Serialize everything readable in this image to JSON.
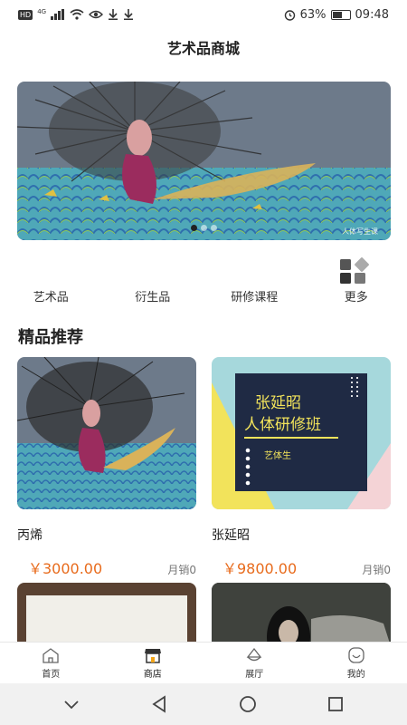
{
  "status": {
    "hd": "HD",
    "network": "4G",
    "battery_text": "63%",
    "battery_level": 0.63,
    "time": "09:48"
  },
  "app": {
    "title": "艺术品商城"
  },
  "banner": {
    "watermark": "人体写生课",
    "slide_count": 3,
    "active_slide": 1
  },
  "categories": [
    {
      "label": "艺术品"
    },
    {
      "label": "衍生品"
    },
    {
      "label": "研修课程"
    },
    {
      "label": "更多",
      "icon": "grid-diamond-icon"
    }
  ],
  "section": {
    "title": "精品推荐"
  },
  "products": [
    {
      "name": "丙烯",
      "price": "￥3000.00",
      "sales": "月销0",
      "image": "mermaid-painting"
    },
    {
      "name": "张延昭",
      "price": "￥9800.00",
      "sales": "月销0",
      "image": "course-poster",
      "poster": {
        "line1": "张延昭",
        "line2": "人体研修班",
        "tag": "艺体生"
      }
    }
  ],
  "tabs": [
    {
      "label": "首页",
      "icon": "home-icon",
      "active": false
    },
    {
      "label": "商店",
      "icon": "shop-icon",
      "active": true
    },
    {
      "label": "展厅",
      "icon": "hall-icon",
      "active": false
    },
    {
      "label": "我的",
      "icon": "profile-icon",
      "active": false
    }
  ],
  "colors": {
    "price": "#e86b1c",
    "poster_navy": "#1f2a44",
    "poster_yellow": "#f2e35b",
    "poster_teal": "#a6d8dc",
    "poster_pink": "#f4d3d6"
  }
}
